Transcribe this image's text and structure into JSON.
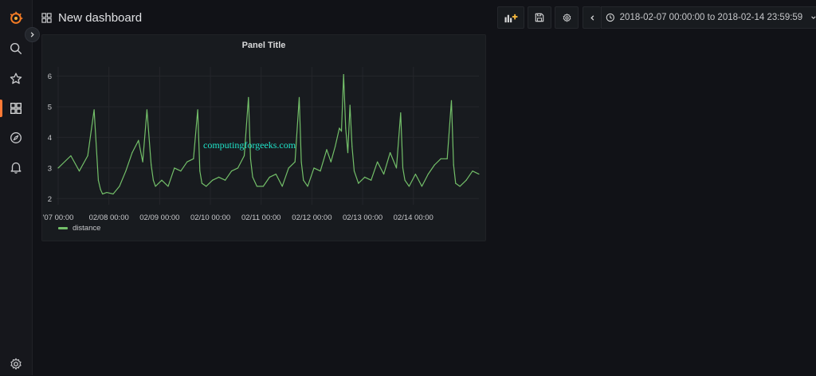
{
  "dashboard": {
    "title": "New dashboard"
  },
  "time_range": {
    "text": "2018-02-07 00:00:00 to 2018-02-14 23:59:59"
  },
  "panel": {
    "title": "Panel Title",
    "watermark": "computingforgeeks.com"
  },
  "colors": {
    "series": "#73bf69",
    "accent": "#ff7a36",
    "watermark": "#1fe3c8"
  },
  "chart_data": {
    "type": "line",
    "title": "Panel Title",
    "xlim": [
      "2018-02-07 00:00",
      "2018-02-15 07:00"
    ],
    "ylim": [
      1.8,
      6.3
    ],
    "y_ticks": [
      2,
      3,
      4,
      5,
      6
    ],
    "x_tick_labels": [
      "'07 00:00",
      "02/08 00:00",
      "02/09 00:00",
      "02/10 00:00",
      "02/11 00:00",
      "02/12 00:00",
      "02/13 00:00",
      "02/14 00:00"
    ],
    "grid": true,
    "legend_position": "bottom-left",
    "series": [
      {
        "name": "distance",
        "x": [
          "2018-02-07 00:00",
          "2018-02-07 06:00",
          "2018-02-07 10:00",
          "2018-02-07 14:00",
          "2018-02-07 17:00",
          "2018-02-07 19:00",
          "2018-02-07 20:00",
          "2018-02-07 21:00",
          "2018-02-07 23:00",
          "2018-02-08 02:00",
          "2018-02-08 05:00",
          "2018-02-08 08:00",
          "2018-02-08 11:00",
          "2018-02-08 14:00",
          "2018-02-08 16:00",
          "2018-02-08 18:00",
          "2018-02-08 20:00",
          "2018-02-08 21:00",
          "2018-02-08 22:00",
          "2018-02-09 01:00",
          "2018-02-09 04:00",
          "2018-02-09 07:00",
          "2018-02-09 10:00",
          "2018-02-09 13:00",
          "2018-02-09 16:00",
          "2018-02-09 18:00",
          "2018-02-09 19:00",
          "2018-02-09 20:00",
          "2018-02-09 22:00",
          "2018-02-10 01:00",
          "2018-02-10 04:00",
          "2018-02-10 07:00",
          "2018-02-10 10:00",
          "2018-02-10 13:00",
          "2018-02-10 16:00",
          "2018-02-10 18:00",
          "2018-02-10 19:00",
          "2018-02-10 20:00",
          "2018-02-10 22:00",
          "2018-02-11 01:00",
          "2018-02-11 04:00",
          "2018-02-11 07:00",
          "2018-02-11 10:00",
          "2018-02-11 13:00",
          "2018-02-11 16:00",
          "2018-02-11 18:00",
          "2018-02-11 19:00",
          "2018-02-11 20:00",
          "2018-02-11 22:00",
          "2018-02-12 01:00",
          "2018-02-12 04:00",
          "2018-02-12 07:00",
          "2018-02-12 09:00",
          "2018-02-12 11:00",
          "2018-02-12 13:00",
          "2018-02-12 14:00",
          "2018-02-12 15:00",
          "2018-02-12 16:00",
          "2018-02-12 17:00",
          "2018-02-12 18:00",
          "2018-02-12 19:00",
          "2018-02-12 20:00",
          "2018-02-12 22:00",
          "2018-02-13 01:00",
          "2018-02-13 04:00",
          "2018-02-13 07:00",
          "2018-02-13 10:00",
          "2018-02-13 13:00",
          "2018-02-13 16:00",
          "2018-02-13 18:00",
          "2018-02-13 19:00",
          "2018-02-13 20:00",
          "2018-02-13 22:00",
          "2018-02-14 01:00",
          "2018-02-14 04:00",
          "2018-02-14 07:00",
          "2018-02-14 10:00",
          "2018-02-14 13:00",
          "2018-02-14 16:00",
          "2018-02-14 18:00",
          "2018-02-14 19:00",
          "2018-02-14 20:00",
          "2018-02-14 22:00",
          "2018-02-15 01:00",
          "2018-02-15 04:00",
          "2018-02-15 07:00"
        ],
        "y": [
          3.0,
          3.4,
          2.9,
          3.4,
          4.9,
          2.6,
          2.3,
          2.15,
          2.2,
          2.15,
          2.4,
          2.9,
          3.5,
          3.9,
          3.2,
          4.9,
          3.1,
          2.6,
          2.4,
          2.6,
          2.4,
          3.0,
          2.9,
          3.2,
          3.3,
          4.9,
          2.9,
          2.5,
          2.4,
          2.6,
          2.7,
          2.6,
          2.9,
          3.0,
          3.4,
          5.3,
          3.3,
          2.7,
          2.4,
          2.4,
          2.7,
          2.8,
          2.4,
          3.0,
          3.2,
          5.3,
          3.2,
          2.6,
          2.4,
          3.0,
          2.9,
          3.6,
          3.2,
          3.7,
          4.3,
          4.2,
          6.05,
          4.3,
          3.5,
          5.05,
          3.7,
          2.9,
          2.5,
          2.7,
          2.6,
          3.2,
          2.8,
          3.5,
          3.0,
          4.8,
          3.0,
          2.6,
          2.4,
          2.8,
          2.4,
          2.8,
          3.1,
          3.3,
          3.3,
          5.2,
          3.1,
          2.5,
          2.4,
          2.6,
          2.9,
          2.8
        ]
      }
    ]
  }
}
